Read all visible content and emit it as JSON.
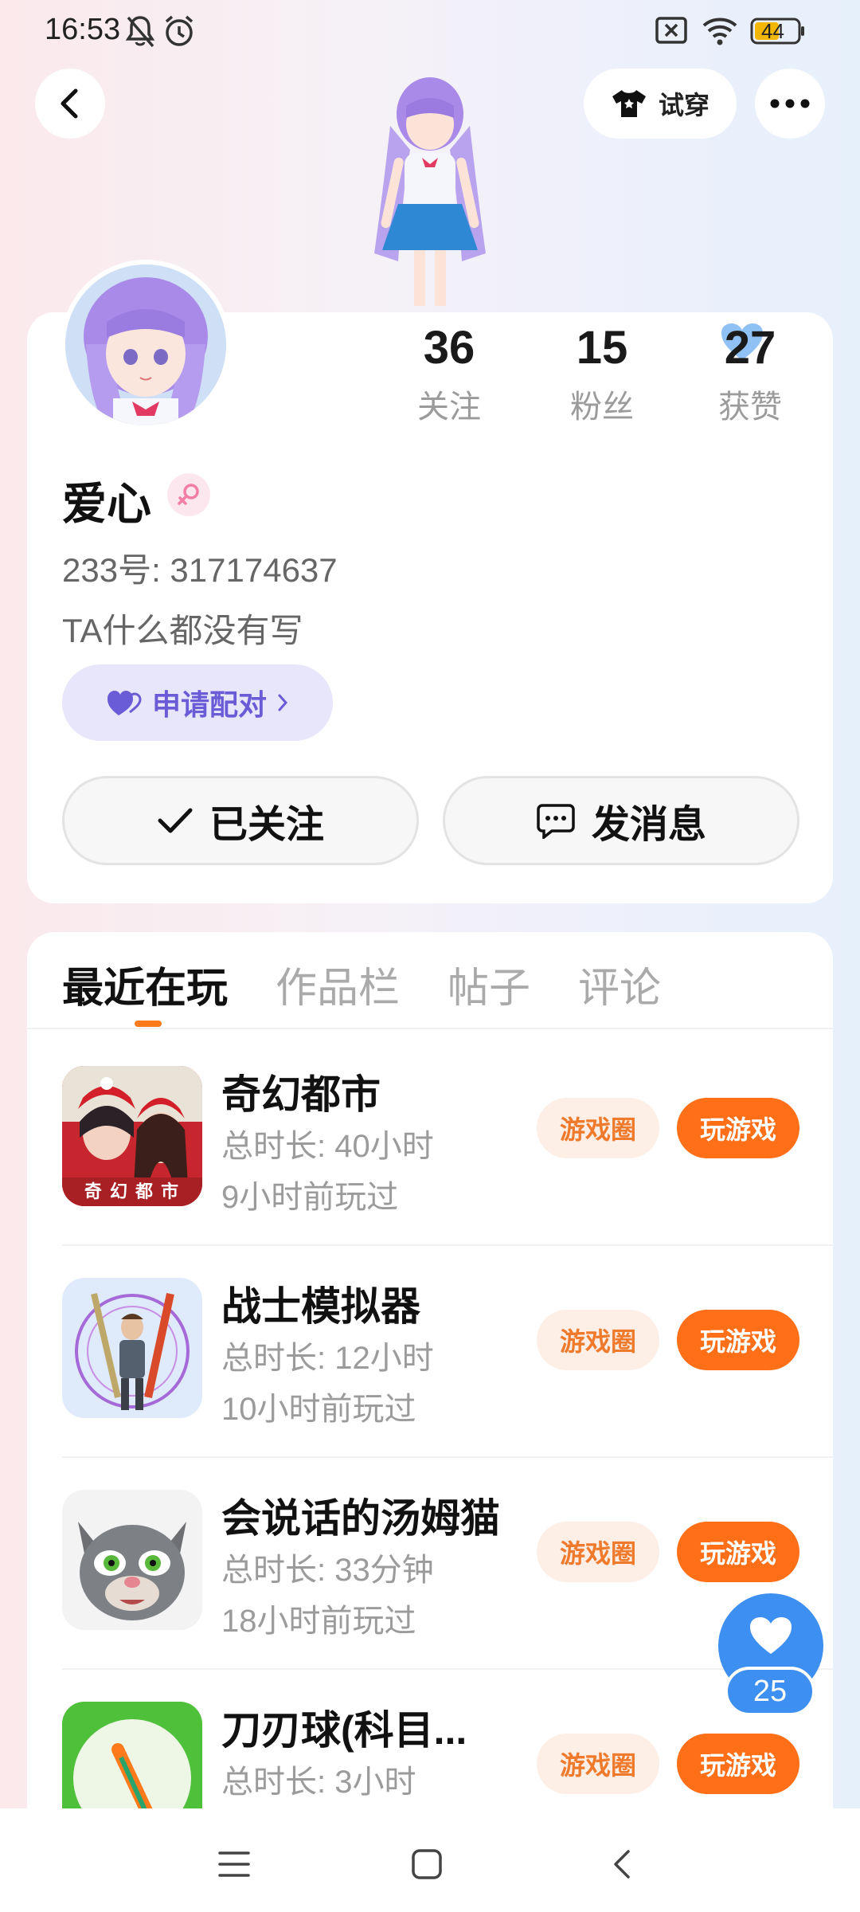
{
  "status_bar": {
    "time": "16:53",
    "battery": "44"
  },
  "header": {
    "try_on_label": "试穿"
  },
  "profile": {
    "stats": [
      {
        "value": "36",
        "label": "关注"
      },
      {
        "value": "15",
        "label": "粉丝"
      },
      {
        "value": "27",
        "label": "获赞"
      }
    ],
    "nickname": "爱心",
    "uid": "233号: 317174637",
    "bio": "TA什么都没有写",
    "pair_label": "申请配对",
    "followed_label": "已关注",
    "message_label": "发消息"
  },
  "tabs": [
    "最近在玩",
    "作品栏",
    "帖子",
    "评论"
  ],
  "games": [
    {
      "name": "奇幻都市",
      "duration": "总时长: 40小时",
      "last_played": "9小时前玩过",
      "circle_label": "游戏圈",
      "play_label": "玩游戏",
      "icon_text": "奇 幻 都 市"
    },
    {
      "name": "战士模拟器",
      "duration": "总时长: 12小时",
      "last_played": "10小时前玩过",
      "circle_label": "游戏圈",
      "play_label": "玩游戏"
    },
    {
      "name": "会说话的汤姆猫",
      "duration": "总时长: 33分钟",
      "last_played": "18小时前玩过",
      "circle_label": "游戏圈",
      "play_label": "玩游戏"
    },
    {
      "name": "刀刃球(科目...",
      "duration": "总时长: 3小时",
      "last_played": "",
      "circle_label": "游戏圈",
      "play_label": "玩游戏"
    }
  ],
  "float_like": {
    "count": "25"
  },
  "colors": {
    "accent": "#ff6f17",
    "like_blue": "#3d8ff2",
    "pair_purple": "#6a5bd7"
  }
}
